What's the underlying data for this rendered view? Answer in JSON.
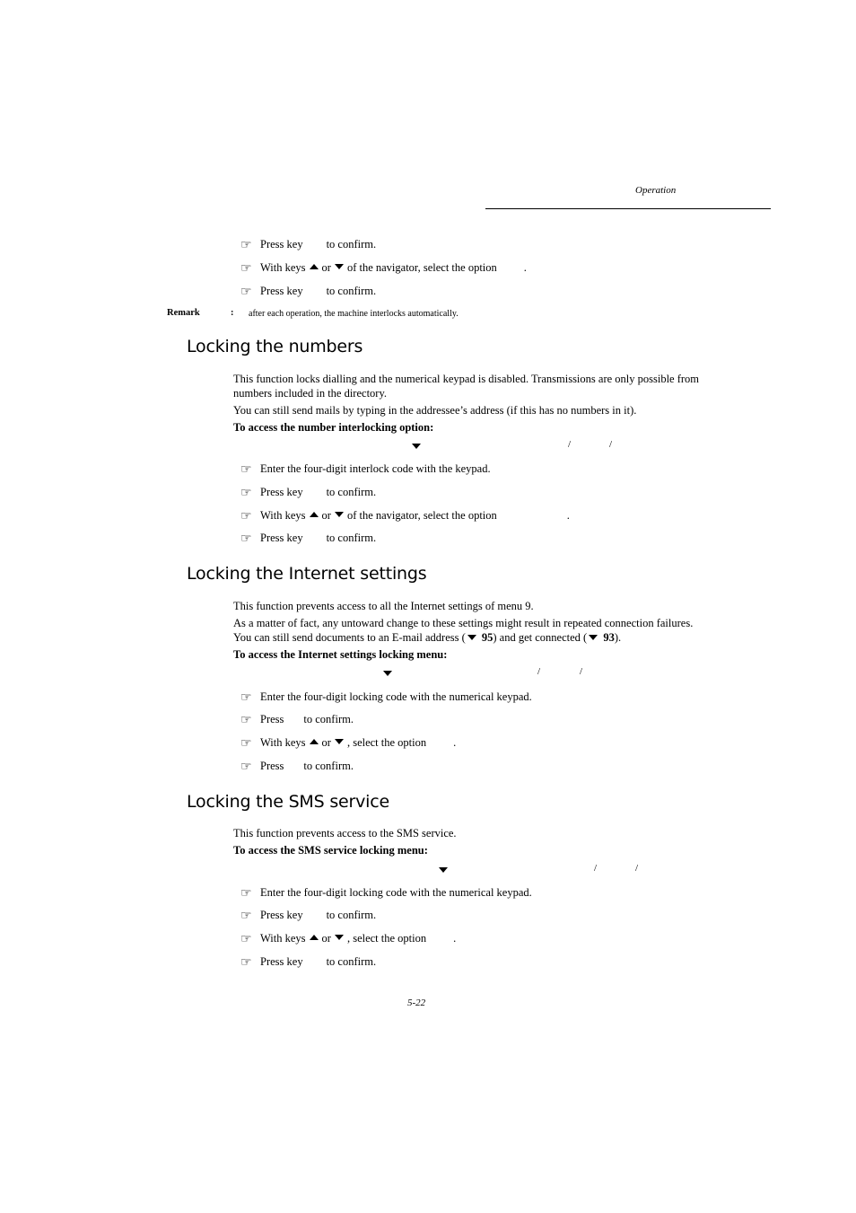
{
  "header": {
    "section": "Operation"
  },
  "intro_steps": [
    {
      "pre": "Press key",
      "post": "to confirm."
    },
    {
      "pre": "With keys",
      "mid": "or",
      "post": "of the navigator, select the option",
      "end": "."
    },
    {
      "pre": "Press key",
      "post": "to confirm."
    }
  ],
  "remark": {
    "label": "Remark",
    "colon": ":",
    "text": "after each operation, the machine interlocks automatically."
  },
  "sections": [
    {
      "title": "Locking the numbers",
      "paragraphs": [
        "This function locks dialling and the numerical keypad is disabled. Transmissions are only possible from numbers included in the directory.",
        "You can still send mails by typing in the addressee’s address (if this has no numbers in it)."
      ],
      "access_label": "To access the number interlocking option:",
      "steps": [
        {
          "text": "Enter the four-digit interlock code with the keypad."
        },
        {
          "pre": "Press key",
          "post": "to confirm."
        },
        {
          "pre": "With keys",
          "mid": "or",
          "post": "of the navigator, select the option",
          "end": "."
        },
        {
          "pre": "Press key",
          "post": "to confirm."
        }
      ]
    },
    {
      "title": "Locking the Internet settings",
      "paragraphs": [
        "This function prevents access to all the Internet settings of menu 9.",
        "As a matter of fact, any untoward change to these settings might result in repeated connection failures."
      ],
      "ref_line": {
        "pre": "You can still send documents to an E-mail address (",
        "ref1": "95",
        "mid": ") and get connected (",
        "ref2": "93",
        "post": ")."
      },
      "access_label": "To access the Internet settings locking menu:",
      "steps": [
        {
          "text": "Enter the four-digit locking code with the numerical keypad."
        },
        {
          "pre": "Press",
          "post": "to confirm."
        },
        {
          "pre": "With keys",
          "mid": "or",
          "post": ", select the option",
          "end": "."
        },
        {
          "pre": "Press",
          "post": "to confirm."
        }
      ]
    },
    {
      "title": "Locking the SMS service",
      "paragraphs": [
        "This function prevents access to the SMS service."
      ],
      "access_label": "To access the SMS service locking menu:",
      "steps": [
        {
          "text": "Enter the four-digit locking code with the numerical keypad."
        },
        {
          "pre": "Press key",
          "post": "to confirm."
        },
        {
          "pre": "With keys",
          "mid": "or",
          "post": ", select the option",
          "end": "."
        },
        {
          "pre": "Press key",
          "post": "to confirm."
        }
      ]
    }
  ],
  "menu_path_separator": "/",
  "footer": {
    "page_number": "5-22"
  }
}
